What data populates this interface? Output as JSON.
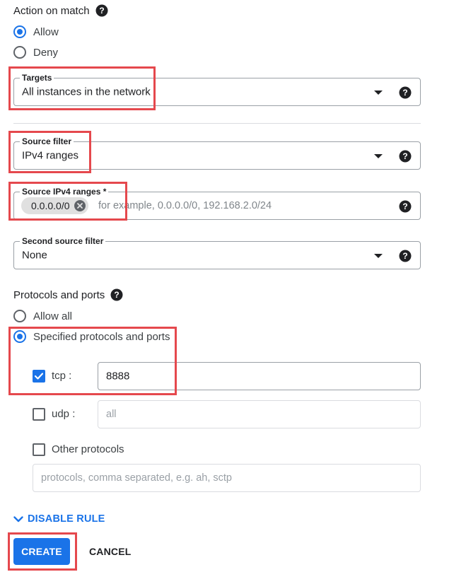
{
  "action": {
    "title": "Action on match",
    "options": [
      {
        "label": "Allow",
        "checked": true
      },
      {
        "label": "Deny",
        "checked": false
      }
    ]
  },
  "targets": {
    "label": "Targets",
    "value": "All instances in the network"
  },
  "source_filter": {
    "label": "Source filter",
    "value": "IPv4 ranges"
  },
  "source_ranges": {
    "label": "Source IPv4 ranges *",
    "chip": "0.0.0.0/0",
    "placeholder": "for example, 0.0.0.0/0, 192.168.2.0/24"
  },
  "second_source_filter": {
    "label": "Second source filter",
    "value": "None"
  },
  "protocols": {
    "title": "Protocols and ports",
    "options": [
      {
        "label": "Allow all",
        "checked": false
      },
      {
        "label": "Specified protocols and ports",
        "checked": true
      }
    ],
    "tcp": {
      "label": "tcp :",
      "checked": true,
      "value": "8888"
    },
    "udp": {
      "label": "udp :",
      "checked": false,
      "placeholder": "all"
    },
    "other": {
      "label": "Other protocols",
      "checked": false,
      "placeholder": "protocols, comma separated, e.g. ah, sctp"
    }
  },
  "disable_rule_label": "DISABLE RULE",
  "create_label": "CREATE",
  "cancel_label": "CANCEL",
  "colors": {
    "accent": "#1a73e8",
    "highlight": "#e5484d"
  },
  "icons": {
    "help": "help-icon",
    "dropdown": "dropdown-arrow-icon",
    "chip_remove": "close-circle-icon",
    "check": "check-icon",
    "chevron": "chevron-down-icon"
  }
}
